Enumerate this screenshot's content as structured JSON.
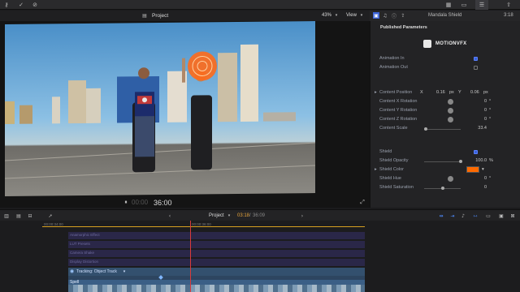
{
  "viewer": {
    "title": "Project",
    "zoom": "43%",
    "view_label": "View",
    "timecode_dim": "00:00",
    "timecode": "36:00"
  },
  "inspector": {
    "title": "Mandala Shield",
    "duration": "3:18",
    "section": "Published Parameters",
    "brand": "MOTIONVFX",
    "shield_color": "#ff6a00",
    "params": [
      {
        "label": "Animation In",
        "type": "checkbox",
        "checked": true
      },
      {
        "label": "Animation Out",
        "type": "checkbox",
        "checked": false
      },
      {
        "label": "Content Position",
        "type": "position",
        "x_label": "X",
        "x": "0.16",
        "x_unit": "px",
        "y_label": "Y",
        "y": "0.06",
        "y_unit": "px"
      },
      {
        "label": "Content X Rotation",
        "type": "dial",
        "value": "0",
        "unit": "°"
      },
      {
        "label": "Content Y Rotation",
        "type": "dial",
        "value": "0",
        "unit": "°"
      },
      {
        "label": "Content Z Rotation",
        "type": "dial",
        "value": "0",
        "unit": "°"
      },
      {
        "label": "Content Scale",
        "type": "slider",
        "value": "33.4",
        "level": 0.05
      },
      {
        "label": "Shield",
        "type": "checkbox",
        "checked": true
      },
      {
        "label": "Shield Opacity",
        "type": "slider",
        "value": "100.0",
        "unit": "%",
        "level": 1.0
      },
      {
        "label": "Shield Color",
        "type": "color"
      },
      {
        "label": "Shield Hue",
        "type": "dial",
        "value": "0",
        "unit": "°"
      },
      {
        "label": "Shield Saturation",
        "type": "slider",
        "value": "0",
        "level": 0.5
      }
    ]
  },
  "timeline": {
    "index_ts": "00:00:34:00",
    "ruler_ts": "00:00:36:00",
    "project_label": "Project",
    "position": "03:18",
    "total": "36:09",
    "lanes": [
      "Anamorphic Effect",
      "LUT Presets",
      "Camera Shake",
      "Display Distortion"
    ],
    "tracking_label": "Tracking: Object Track",
    "clip_label": "Spell"
  }
}
